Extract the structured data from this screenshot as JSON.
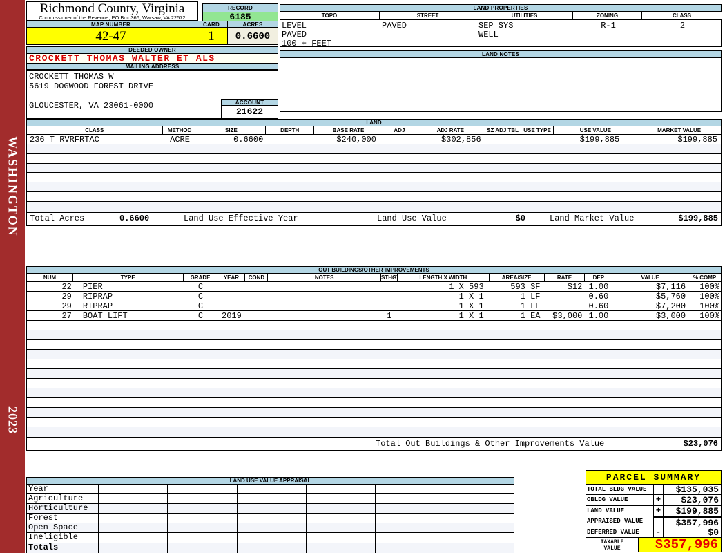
{
  "colors": {
    "spine_red": "#A22C2C",
    "header_blue": "#B3D6E4",
    "record_green": "#92E692",
    "yellow": "#FFFF00",
    "cream": "#F1EFE0",
    "stripe": "#F3F5FA",
    "owner_red": "#D40000",
    "taxable_red": "#E60000"
  },
  "sidebar": {
    "county": "WASHINGTON",
    "year": "2023"
  },
  "header": {
    "county_title": "Richmond County, Virginia",
    "commissioner_line": "Commissioner of the Revenue, PO Box 366, Warsaw, VA 22572",
    "record_label": "RECORD",
    "record_value": "6185",
    "map_number_label": "MAP NUMBER",
    "map_number": "42-47",
    "card_label": "CARD",
    "card": "1",
    "acres_label": "ACRES",
    "acres": "0.6600",
    "deeded_owner_label": "DEEDED OWNER",
    "deeded_owner": "CROCKETT THOMAS WALTER ET ALS",
    "mailing_address_label": "MAILING ADDRESS",
    "mailing_address_lines": [
      "CROCKETT THOMAS W",
      "5619 DOGWOOD FOREST DRIVE",
      "",
      "GLOUCESTER, VA 23061-0000"
    ],
    "account_label": "ACCOUNT",
    "account": "21622"
  },
  "land_properties": {
    "title": "LAND PROPERTIES",
    "columns": [
      "TOPO",
      "STREET",
      "UTILITIES",
      "ZONING",
      "CLASS"
    ],
    "topo": [
      "LEVEL",
      "PAVED",
      "100 + FEET"
    ],
    "street": [
      "PAVED"
    ],
    "utilities": [
      "SEP SYS",
      "WELL"
    ],
    "zoning": [
      "R-1"
    ],
    "class": [
      "2"
    ]
  },
  "land_notes": {
    "title": "LAND NOTES"
  },
  "land": {
    "title": "LAND",
    "columns": [
      "CLASS",
      "METHOD",
      "SIZE",
      "DEPTH",
      "BASE RATE",
      "ADJ",
      "ADJ RATE",
      "SZ ADJ TBL",
      "USE TYPE",
      "USE VALUE",
      "MARKET VALUE"
    ],
    "rows": [
      {
        "class": "236 T RVRFRTAC",
        "method": "ACRE",
        "size": "0.6600",
        "depth": "",
        "base_rate": "$240,000",
        "adj": "",
        "adj_rate": "$302,856",
        "sz_adj_tbl": "",
        "use_type": "",
        "use_value": "$199,885",
        "market_value": "$199,885"
      }
    ],
    "totals": {
      "total_acres_label": "Total Acres",
      "total_acres": "0.6600",
      "effective_year_label": "Land Use Effective Year",
      "use_value_label": "Land Use Value",
      "use_value": "$0",
      "market_value_label": "Land Market Value",
      "market_value": "$199,885"
    }
  },
  "out_buildings": {
    "title": "OUT BUILDINGS/OTHER IMPROVEMENTS",
    "columns": [
      "NUM",
      "TYPE",
      "GRADE",
      "YEAR",
      "COND",
      "NOTES",
      "STHGT",
      "LENGTH X WIDTH",
      "AREA/SIZE",
      "RATE",
      "DEP",
      "VALUE",
      "% COMP"
    ],
    "rows": [
      {
        "num": "22",
        "type": "PIER",
        "grade": "C",
        "year": "",
        "cond": "",
        "notes": "",
        "sthgt": "",
        "lxw": "1 X 593",
        "area": "593 SF",
        "rate": "$12",
        "dep": "1.00",
        "value": "$7,116",
        "comp": "100%"
      },
      {
        "num": "29",
        "type": "RIPRAP",
        "grade": "C",
        "year": "",
        "cond": "",
        "notes": "",
        "sthgt": "",
        "lxw": "1 X 1",
        "area": "1 LF",
        "rate": "",
        "dep": "0.60",
        "value": "$5,760",
        "comp": "100%"
      },
      {
        "num": "29",
        "type": "RIPRAP",
        "grade": "C",
        "year": "",
        "cond": "",
        "notes": "",
        "sthgt": "",
        "lxw": "1 X 1",
        "area": "1 LF",
        "rate": "",
        "dep": "0.60",
        "value": "$7,200",
        "comp": "100%"
      },
      {
        "num": "27",
        "type": "BOAT LIFT",
        "grade": "C",
        "year": "2019",
        "cond": "",
        "notes": "",
        "sthgt": "1",
        "lxw": "1 X 1",
        "area": "1 EA",
        "rate": "$3,000",
        "dep": "1.00",
        "value": "$3,000",
        "comp": "100%"
      }
    ],
    "total_label": "Total Out Buildings & Other Improvements Value",
    "total_value": "$23,076"
  },
  "land_use_appraisal": {
    "title": "LAND USE VALUE APPRAISAL",
    "row_labels": [
      "Year",
      "Agriculture",
      "Horticulture",
      "Forest",
      "Open Space",
      "Ineligible",
      "Totals"
    ],
    "num_columns": 6
  },
  "parcel_summary": {
    "title": "PARCEL SUMMARY",
    "rows": [
      {
        "label": "TOTAL BLDG VALUE",
        "op": "",
        "value": "$135,035"
      },
      {
        "label": "OBLDG VALUE",
        "op": "+",
        "value": "$23,076"
      },
      {
        "label": "LAND VALUE",
        "op": "+",
        "value": "$199,885"
      },
      {
        "label": "APPRAISED VALUE",
        "op": "",
        "value": "$357,996"
      },
      {
        "label": "DEFERRED VALUE",
        "op": "-",
        "value": "$0"
      }
    ],
    "taxable_label": "TAXABLE VALUE",
    "taxable_value": "$357,996"
  }
}
